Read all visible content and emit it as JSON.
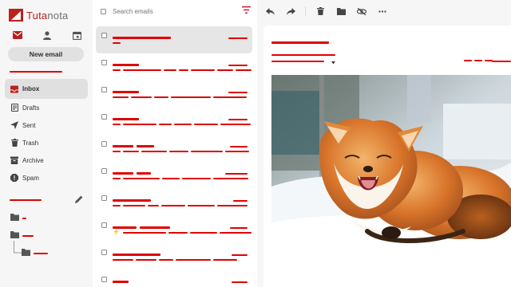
{
  "app": {
    "brand_prefix": "Tuta",
    "brand_suffix": "nota"
  },
  "sidebar": {
    "top_icons": [
      "mail-icon",
      "contacts-icon",
      "calendar-icon"
    ],
    "new_email_label": "New email",
    "items": [
      {
        "label": "Inbox",
        "icon": "inbox-icon",
        "active": true
      },
      {
        "label": "Drafts",
        "icon": "drafts-icon"
      },
      {
        "label": "Sent",
        "icon": "send-icon"
      },
      {
        "label": "Trash",
        "icon": "trash-icon"
      },
      {
        "label": "Archive",
        "icon": "archive-icon"
      },
      {
        "label": "Spam",
        "icon": "spam-icon"
      }
    ],
    "folders_edit_icon": "pencil-icon"
  },
  "list": {
    "search_placeholder": "Search emails",
    "filter_icon": "filter-icon",
    "row_count": 10,
    "selected_row": 0
  },
  "reader": {
    "toolbar_icons": [
      "reply-icon",
      "forward-icon",
      "delete-icon",
      "move-to-folder-icon",
      "hide-icon",
      "more-icon"
    ],
    "image_subject": "fox-yawning-in-snow"
  },
  "colors": {
    "brand": "#b9211f",
    "redaction": "#e00000",
    "sidebar_bg": "#f6f6f6",
    "selected_bg": "#e6e6e6"
  }
}
